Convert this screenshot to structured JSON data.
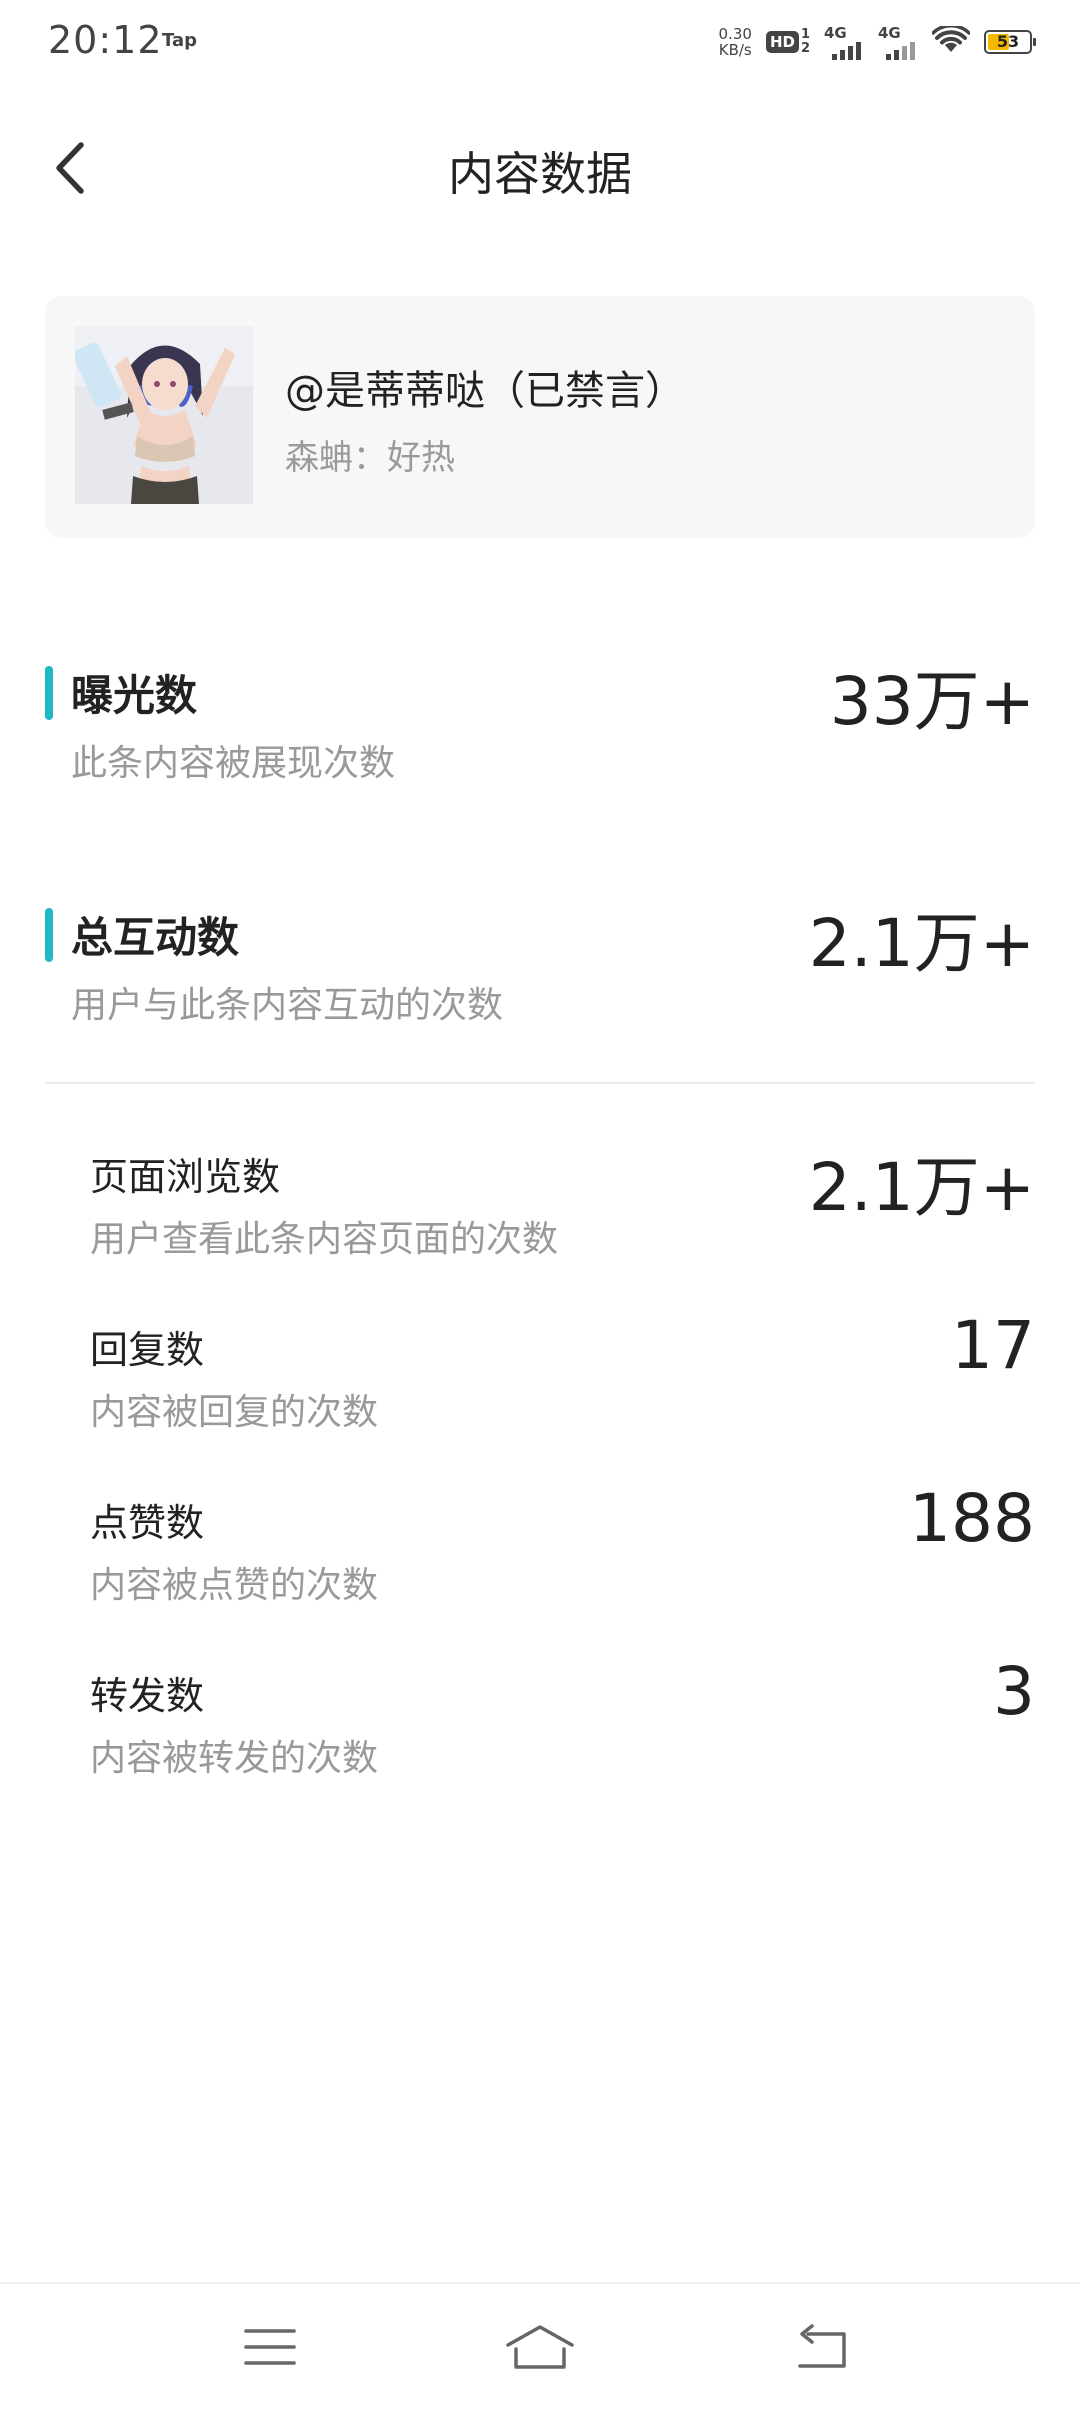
{
  "status_bar": {
    "time": "20:12",
    "app_label": "Tap",
    "net_speed_value": "0.30",
    "net_speed_unit": "KB/s",
    "hd_label": "HD",
    "hd_sim_top": "1",
    "hd_sim_bottom": "2",
    "signal_1_label": "4G",
    "signal_2_label": "4G",
    "battery_level": "53",
    "battery_color": "#f5b800"
  },
  "header": {
    "title": "内容数据",
    "back_icon": "chevron-left-icon"
  },
  "post": {
    "author": "@是蒂蒂哒（已禁言）",
    "snippet": "森蚺：好热",
    "thumbnail": "anime-character-image"
  },
  "primary_metrics": [
    {
      "title": "曝光数",
      "description": "此条内容被展现次数",
      "value": "33万+"
    },
    {
      "title": "总互动数",
      "description": "用户与此条内容互动的次数",
      "value": "2.1万+"
    }
  ],
  "sub_metrics": [
    {
      "title": "页面浏览数",
      "description": "用户查看此条内容页面的次数",
      "value": "2.1万+"
    },
    {
      "title": "回复数",
      "description": "内容被回复的次数",
      "value": "17"
    },
    {
      "title": "点赞数",
      "description": "内容被点赞的次数",
      "value": "188"
    },
    {
      "title": "转发数",
      "description": "内容被转发的次数",
      "value": "3"
    }
  ],
  "nav_bar": {
    "menu_icon": "menu-icon",
    "home_icon": "home-icon",
    "back_icon": "back-icon"
  },
  "colors": {
    "accent": "#1fb8c3",
    "card_background": "#f7f7f7",
    "secondary_text": "#999999"
  }
}
